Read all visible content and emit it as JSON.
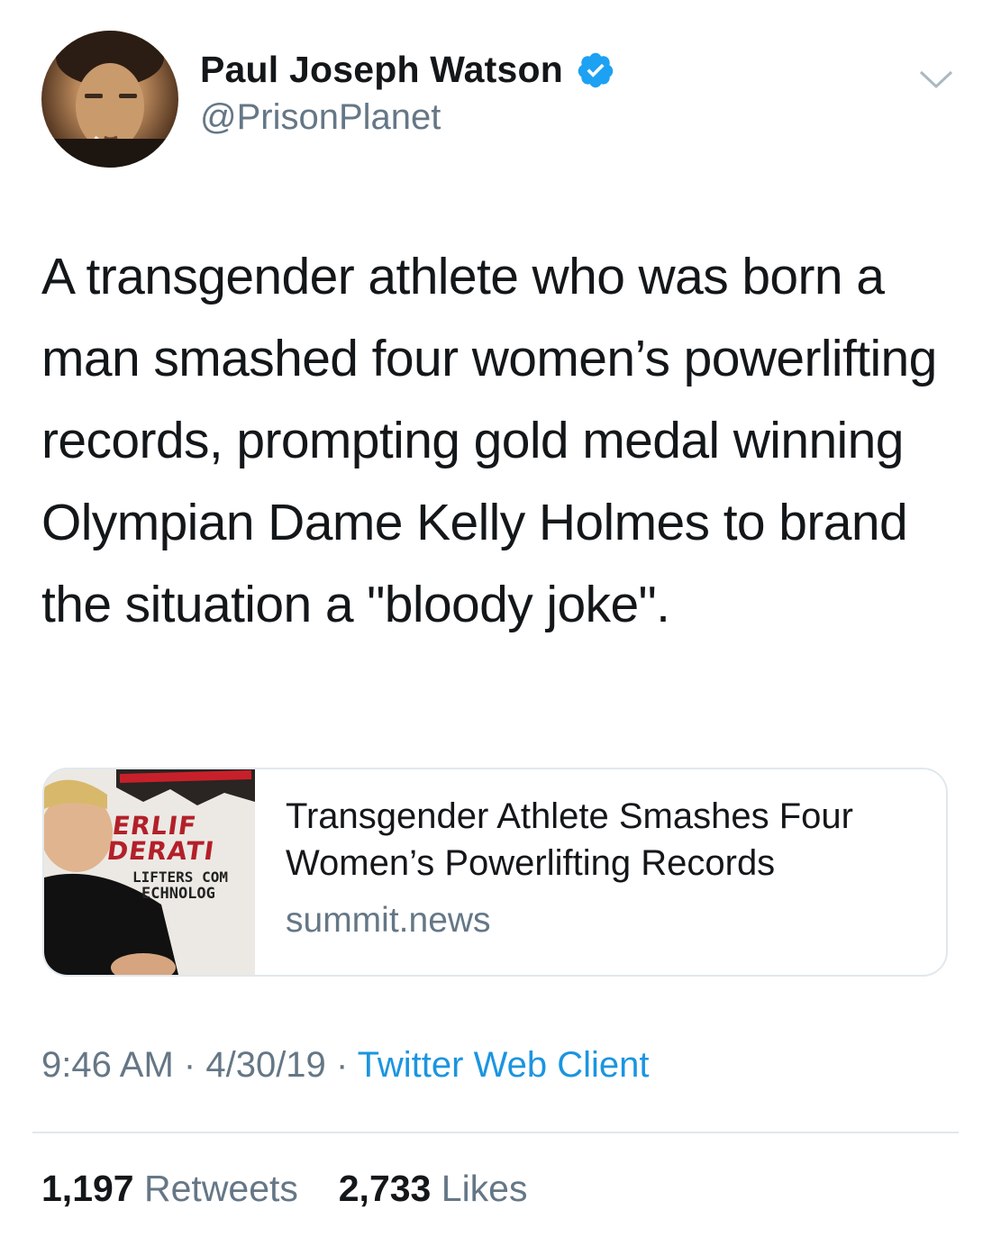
{
  "author": {
    "name": "Paul Joseph Watson",
    "handle": "@PrisonPlanet",
    "verified": true
  },
  "tweet": {
    "text": "A transgender athlete who was born a man smashed four women’s powerlifting records, prompting gold medal winning Olympian Dame Kelly Holmes to brand the situation a \"bloody joke\"."
  },
  "card": {
    "title": "Transgender Athlete Smashes Four Women’s Powerlifting Records",
    "domain": "summit.news",
    "thumbnail_text": {
      "line1": "ERLIF",
      "line2": "DERATI",
      "line3": "LIFTERS COM",
      "line4": "ECHNOLOG"
    }
  },
  "meta": {
    "time": "9:46 AM",
    "date": "4/30/19",
    "client": "Twitter Web Client",
    "separator": "·"
  },
  "stats": {
    "retweets_count": "1,197",
    "retweets_label": "Retweets",
    "likes_count": "2,733",
    "likes_label": "Likes"
  },
  "colors": {
    "text": "#14171a",
    "secondary": "#657786",
    "link": "#1b95e0",
    "verified": "#1da1f2",
    "border": "#e1e8ed"
  },
  "icons": {
    "verified": "verified-badge-icon",
    "chevron": "chevron-down-icon"
  }
}
